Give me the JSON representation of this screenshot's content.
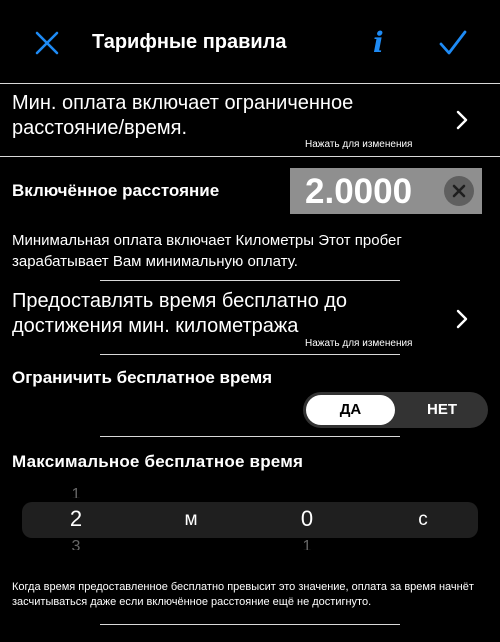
{
  "nav": {
    "title": "Тарифные правила",
    "close_icon": "close-icon",
    "info_icon": "info-icon",
    "info_glyph": "i",
    "done_icon": "checkmark-icon",
    "accent": "#1e8bf5"
  },
  "min_fare_row": {
    "label": "Мин. оплата включает ограниченное расстояние/время.",
    "hint": "Нажать для изменения"
  },
  "included_distance": {
    "label": "Включённое расстояние",
    "value": "2.0000"
  },
  "description": "Минимальная оплата включает Километры Этот пробег зарабатывает Вам минимальную оплату.",
  "free_time_row": {
    "label": "Предоставлять время бесплатно до достижения мин. километража",
    "hint": "Нажать для изменения"
  },
  "limit_free_time": {
    "label": "Ограничить бесплатное время",
    "options": [
      "ДА",
      "НЕТ"
    ],
    "selected": "ДА"
  },
  "max_free_time": {
    "heading": "Максимальное бесплатное время",
    "picker": {
      "minutes_above": "1",
      "minutes": "2",
      "minutes_below": "3",
      "minutes_unit": "м",
      "seconds": "0",
      "seconds_below": "1",
      "seconds_unit": "с"
    }
  },
  "footnote": "Когда время предоставленное бесплатно превысит это значение, оплата за время начнёт засчитываться даже если включённое расстояние ещё не достигнуто."
}
